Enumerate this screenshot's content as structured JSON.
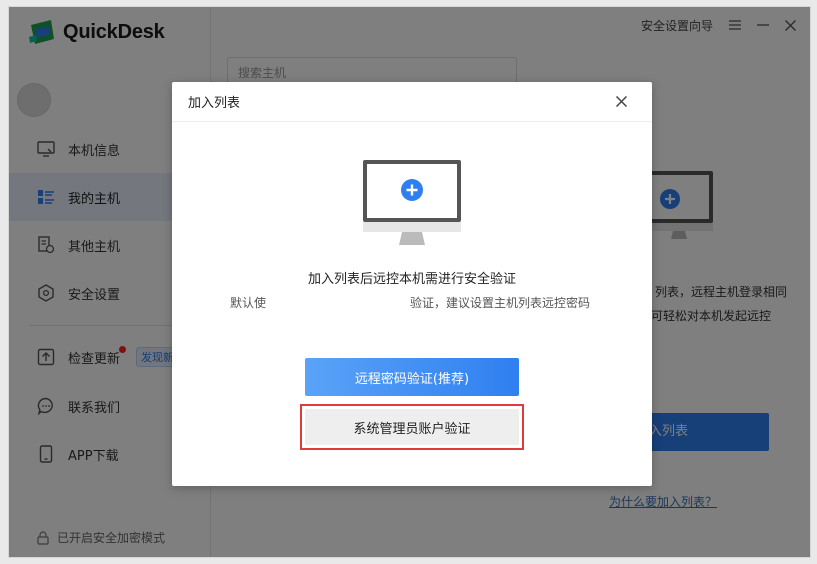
{
  "app": {
    "logo_text": "QuickDesk",
    "accent_color": "#2f7ff0"
  },
  "titlebar": {
    "security_guide": "安全设置向导",
    "menu_icon": "menu-icon",
    "minimize_icon": "minimize-icon",
    "close_icon": "close-icon"
  },
  "sidebar": {
    "items": [
      {
        "label": "本机信息",
        "icon": "monitor-icon"
      },
      {
        "label": "我的主机",
        "icon": "host-list-icon",
        "active": true
      },
      {
        "label": "其他主机",
        "icon": "other-host-icon"
      },
      {
        "label": "安全设置",
        "icon": "shield-icon"
      }
    ],
    "secondary_items": [
      {
        "label": "检查更新",
        "icon": "update-icon",
        "badge": "发现新"
      },
      {
        "label": "联系我们",
        "icon": "chat-icon"
      },
      {
        "label": "APP下载",
        "icon": "phone-icon"
      }
    ],
    "secure_mode": "已开启安全加密模式"
  },
  "main": {
    "search_placeholder": "搜索主机",
    "bg_text_line1": "列表，远程主机登录相同",
    "bg_text_line2": "可轻松对本机发起远控",
    "bg_text_left": "默认",
    "add_button": "入列表",
    "why_link": "为什么要加入列表？"
  },
  "dialog": {
    "title": "加入列表",
    "heading": "加入列表后远控本机需进行安全验证",
    "sub_left": "默认使",
    "sub_right": "验证，建议设置主机列表远控密码",
    "primary_button": "远程密码验证(推荐)",
    "secondary_button": "系统管理员账户验证"
  }
}
